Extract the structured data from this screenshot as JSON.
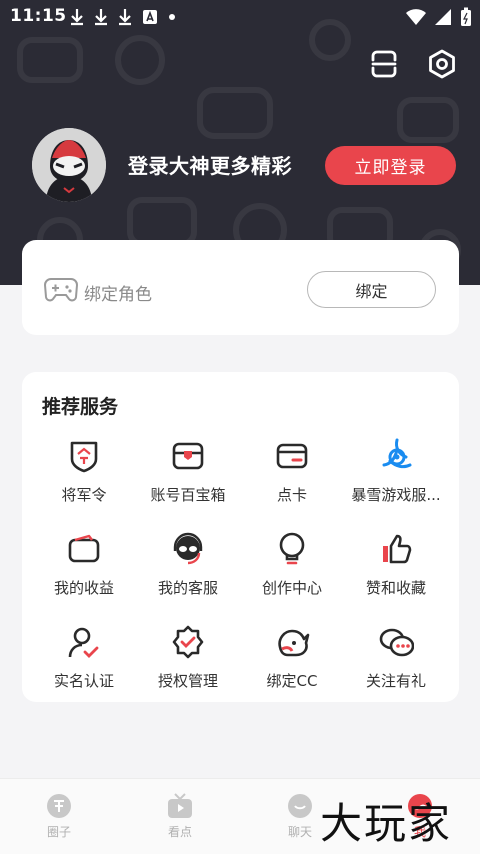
{
  "status_bar": {
    "time": "11:15"
  },
  "header": {
    "login_prompt": "登录大神更多精彩",
    "login_button": "立即登录"
  },
  "bind_card": {
    "label": "绑定角色",
    "button": "绑定"
  },
  "services": {
    "title": "推荐服务",
    "items": [
      {
        "label": "将军令",
        "icon": "shield-token-icon"
      },
      {
        "label": "账号百宝箱",
        "icon": "treasure-box-icon"
      },
      {
        "label": "点卡",
        "icon": "card-icon"
      },
      {
        "label": "暴雪游戏服...",
        "icon": "blizzard-icon"
      },
      {
        "label": "我的收益",
        "icon": "wallet-icon"
      },
      {
        "label": "我的客服",
        "icon": "headset-icon"
      },
      {
        "label": "创作中心",
        "icon": "bulb-icon"
      },
      {
        "label": "赞和收藏",
        "icon": "thumbs-up-icon"
      },
      {
        "label": "实名认证",
        "icon": "user-verify-icon"
      },
      {
        "label": "授权管理",
        "icon": "badge-check-icon"
      },
      {
        "label": "绑定CC",
        "icon": "cc-mascot-icon"
      },
      {
        "label": "关注有礼",
        "icon": "chat-bubbles-icon"
      }
    ]
  },
  "bottom_nav": [
    {
      "label": "圈子",
      "icon": "circle-god-icon"
    },
    {
      "label": "看点",
      "icon": "tv-icon"
    },
    {
      "label": "聊天",
      "icon": "chat-icon"
    },
    {
      "label": "我",
      "icon": "me-icon"
    }
  ],
  "watermark": "大玩家",
  "colors": {
    "accent": "#e9454c",
    "header_bg": "#2b2b35"
  }
}
